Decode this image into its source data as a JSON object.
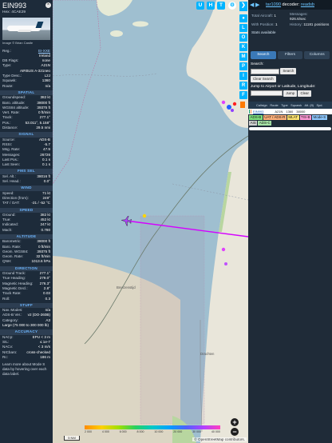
{
  "aircraft": {
    "callsign": "EIN993",
    "hex_label": "Hex:",
    "hex": "4CAE29",
    "photo_credit": "Image © Brian Castle",
    "reg_label": "Reg.:",
    "reg": "EI-XXE",
    "country": "Ireland",
    "db_flags_label": "DB Flags:",
    "db_flags": "none",
    "type_label": "Type:",
    "type": "A21N",
    "type_full": "AIRBUS A-321neo",
    "type_desc_label": "Type Desc.:",
    "type_desc": "L2J",
    "squawk_label": "Squawk:",
    "squawk": "1360",
    "route_label": "Route:",
    "route": "n/a"
  },
  "sections": {
    "spatial": {
      "title": "SPATIAL",
      "rows": [
        {
          "k": "Groundspeed:",
          "v": "382 kt"
        },
        {
          "k": "Baro. altitude:",
          "v": "38000 ft"
        },
        {
          "k": "WGS84 altitude:",
          "v": "39375 ft"
        },
        {
          "k": "Vert. Rate:",
          "v": "0 ft/min"
        },
        {
          "k": "Track:",
          "v": "277.1°"
        },
        {
          "k": "Pos.:",
          "v": "53.011°, 5.158°"
        },
        {
          "k": "Distance:",
          "v": "29.5 nmi"
        }
      ]
    },
    "signal": {
      "title": "SIGNAL",
      "rows": [
        {
          "k": "Source:",
          "v": "ADS-B"
        },
        {
          "k": "RSSI:",
          "v": "-5.7"
        },
        {
          "k": "Msg. Rate:",
          "v": "47.9"
        },
        {
          "k": "Messages:",
          "v": "26726"
        },
        {
          "k": "Last Pos.:",
          "v": "0.1 s"
        },
        {
          "k": "Last Seen:",
          "v": "0.1 s"
        }
      ]
    },
    "fms": {
      "title": "FMS SEL",
      "rows": [
        {
          "k": "Sel. Alt.:",
          "v": "38016 ft"
        },
        {
          "k": "Sel. Head.:",
          "v": "0.0°"
        }
      ]
    },
    "wind": {
      "title": "WIND",
      "rows": [
        {
          "k": "Speed:",
          "v": "71 kt"
        },
        {
          "k": "Direction (from):",
          "v": "249°"
        },
        {
          "k": "TAT / OAT:",
          "v": "-21 / -52 °C"
        }
      ]
    },
    "speed": {
      "title": "SPEED",
      "rows": [
        {
          "k": "Ground:",
          "v": "382 kt"
        },
        {
          "k": "True:",
          "v": "452 kt"
        },
        {
          "k": "Indicated:",
          "v": "247 kt"
        },
        {
          "k": "Mach:",
          "v": "0.780"
        }
      ]
    },
    "altitude": {
      "title": "ALTITUDE",
      "rows": [
        {
          "k": "Barometric:",
          "v": "38000 ft"
        },
        {
          "k": "Baro. Rate:",
          "v": "0 ft/min"
        },
        {
          "k": "Geom. WGS84:",
          "v": "39375 ft"
        },
        {
          "k": "Geom. Rate:",
          "v": "32 ft/min"
        },
        {
          "k": "QNH:",
          "v": "1013.6 hPa"
        }
      ]
    },
    "direction": {
      "title": "DIRECTION",
      "rows": [
        {
          "k": "Ground Track:",
          "v": "277.1°"
        },
        {
          "k": "True Heading:",
          "v": "279.0°"
        },
        {
          "k": "Magnetic Heading:",
          "v": "276.3°"
        },
        {
          "k": "Magnetic Decl.:",
          "v": "2.8°"
        },
        {
          "k": "Track Rate:",
          "v": "0.03"
        },
        {
          "k": "Roll:",
          "v": "0.3"
        }
      ]
    },
    "stuff": {
      "title": "STUFF",
      "rows": [
        {
          "k": "Nav. Modes:",
          "v": "n/a"
        },
        {
          "k": "ADS-B Ver.:",
          "v": "v2 (DO-260B)"
        },
        {
          "k": "Category:",
          "v": "A3"
        }
      ],
      "category_desc": "Large (75 000 to 300 000 lb)"
    },
    "accuracy": {
      "title": "ACCURACY",
      "rows": [
        {
          "k": "NACp:",
          "v": "EPU < 3 m"
        },
        {
          "k": "SIL:",
          "v": "≤ 1e-7"
        },
        {
          "k": "NACv:",
          "v": "< 3 m/s"
        },
        {
          "k": "NICbaro:",
          "v": "cross-checked"
        },
        {
          "k": "Rc:",
          "v": "186 m"
        }
      ]
    },
    "footer": "Learn more about Mode S data by hovering over each data label."
  },
  "map": {
    "top_buttons": [
      "U",
      "H",
      "T"
    ],
    "vertical_buttons": [
      "L",
      "O",
      "K",
      "M",
      "P",
      "I",
      "R",
      "F"
    ],
    "zoom_in": "+",
    "zoom_out": "−",
    "scale_label": "5 NM",
    "attribution": "© OpenStreetMap contributors.",
    "legend_labels": [
      "2 000",
      "4 000",
      "6 000",
      "8 000",
      "10 000",
      "20 000",
      "30 000",
      "40 000"
    ],
    "place_labels": [
      "Brenzenstijd",
      "Drachten"
    ]
  },
  "panel": {
    "title_prefix": "tar1090",
    "title_mid": "decoder:",
    "title_link": "readsb",
    "stats": {
      "total_label": "Total Aircraft:",
      "total_value": "1",
      "with_pos_label": "With Position:",
      "with_pos_value": "1",
      "stats_available": "Stats available",
      "messages_label": "Messages:",
      "messages_value": "926.6/sec",
      "history_label": "History:",
      "history_value": "11181 positions"
    },
    "tabs": [
      "Search",
      "Filters",
      "Columns"
    ],
    "search_label": "Search:",
    "search_btn": "Search",
    "clear_btn": "Clear Search",
    "jump_label": "Jump to Airport or Latitude, Longitude:",
    "jump_btn": "Jump",
    "clear2_btn": "Clear",
    "table_headers": [
      "Callsign",
      "Route",
      "Type",
      "Squawk",
      "Alt. (ft)",
      "Spd."
    ],
    "table_row": {
      "callsign": "EIN993",
      "type": "A21N",
      "squawk": "1360",
      "alt": "38000"
    },
    "badges": [
      {
        "label": "ADS-B",
        "color": "#7fe07f"
      },
      {
        "label": "UAT / ADS-R",
        "color": "#ffb07a"
      },
      {
        "label": "MLAT",
        "color": "#ffe36e"
      },
      {
        "label": "TIS-B",
        "color": "#ff9ad6"
      },
      {
        "label": "Mode-S",
        "color": "#8ec8ff"
      },
      {
        "label": "AIS",
        "color": "#d0d0d0"
      },
      {
        "label": "ADS-C",
        "color": "#a6e3a6"
      }
    ]
  },
  "colors": {
    "accent": "#00b4ff",
    "track_magenta": "#d400ff",
    "aircraft": "#b040ff"
  }
}
